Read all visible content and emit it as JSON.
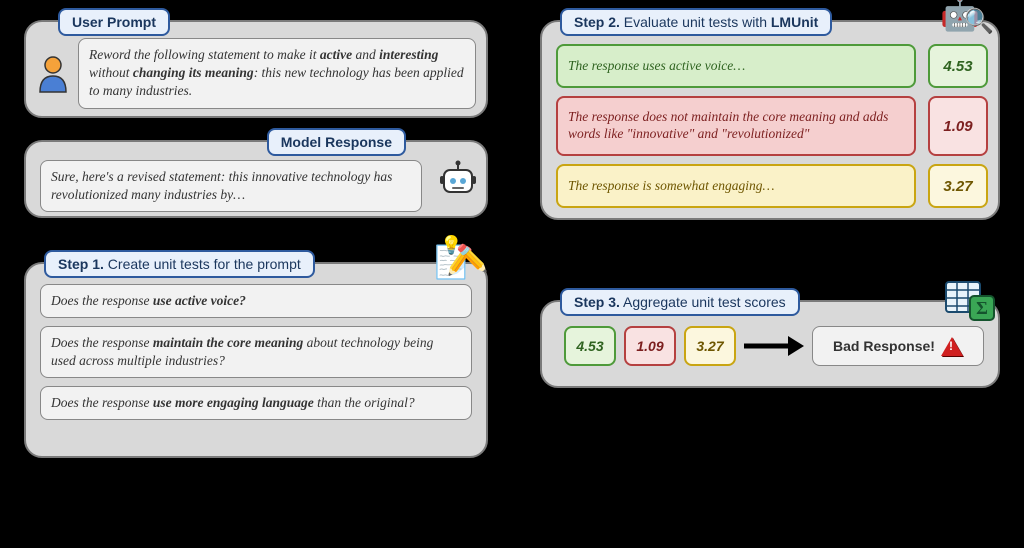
{
  "user_prompt": {
    "title": "User Prompt",
    "text_pre": "Reword the following statement to make it ",
    "b1": "active",
    "mid1": " and ",
    "b2": "interesting",
    "mid2": " without ",
    "b3": "changing its meaning",
    "text_post": ": this new technology has been applied to many industries."
  },
  "model_response": {
    "title": "Model Response",
    "text": "Sure, here's a revised statement: this innovative technology has revolutionized many industries by…"
  },
  "step1": {
    "label": "Step 1.",
    "title": " Create unit tests for the prompt",
    "a_pre": "Does the response ",
    "a_b": "use active voice?",
    "b_pre": "Does the response ",
    "b_b": "maintain the core meaning",
    "b_post": " about technology being used across multiple industries?",
    "c_pre": "Does the response ",
    "c_b": "use more engaging language",
    "c_post": " than the original?"
  },
  "step2": {
    "label": "Step 2.",
    "title": " Evaluate unit tests with ",
    "brand": "LMUnit",
    "r1_text": "The response uses active voice…",
    "r1_score": "4.53",
    "r2_text": "The response does not maintain the core meaning and adds words like \"innovative\" and \"revolutionized\"",
    "r2_score": "1.09",
    "r3_text": "The response is somewhat engaging…",
    "r3_score": "3.27"
  },
  "step3": {
    "label": "Step 3.",
    "title": " Aggregate unit test scores",
    "s1": "4.53",
    "s2": "1.09",
    "s3": "3.27",
    "verdict": "Bad Response!"
  }
}
